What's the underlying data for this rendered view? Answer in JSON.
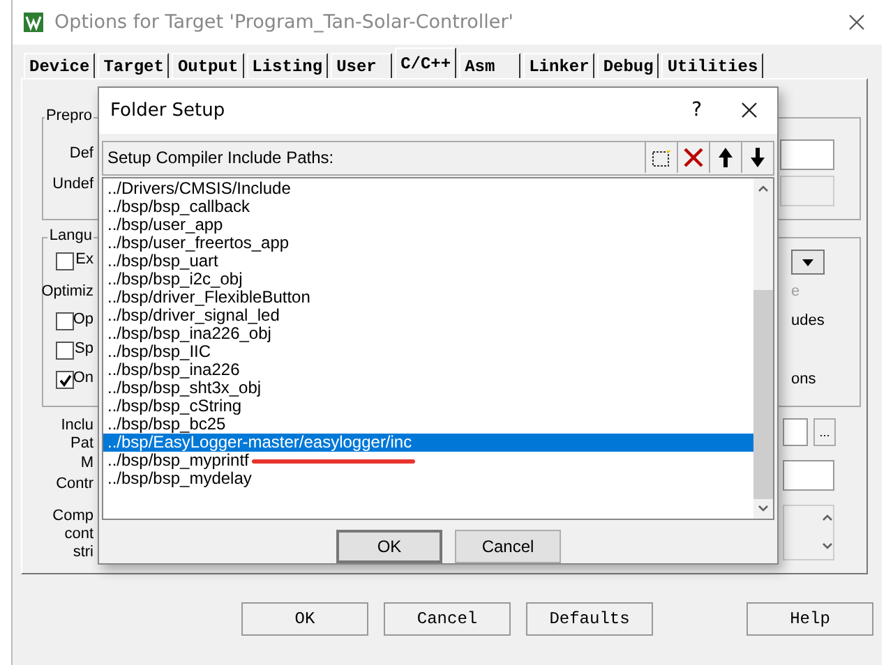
{
  "window": {
    "title": "Options for Target 'Program_Tan-Solar-Controller'"
  },
  "tabs": [
    {
      "label": "Device",
      "selected": false
    },
    {
      "label": "Target",
      "selected": false
    },
    {
      "label": "Output",
      "selected": false
    },
    {
      "label": "Listing",
      "selected": false
    },
    {
      "label": "User",
      "selected": false
    },
    {
      "label": "C/C++",
      "selected": true
    },
    {
      "label": "Asm",
      "selected": false
    },
    {
      "label": "Linker",
      "selected": false
    },
    {
      "label": "Debug",
      "selected": false
    },
    {
      "label": "Utilities",
      "selected": false
    }
  ],
  "background_panel": {
    "preprocessor_group": "Prepro",
    "define_label": "Def",
    "undefine_label": "Undef",
    "language_group": "Langu",
    "optimization_label": "Optimiz",
    "checkboxes": [
      {
        "label": "Ex",
        "checked": false
      },
      {
        "label": "Op",
        "checked": false
      },
      {
        "label": "Sp",
        "checked": false
      },
      {
        "label": "On",
        "checked": true
      }
    ],
    "right_labels": [
      {
        "text": "e",
        "disabled": true
      },
      {
        "text": "udes",
        "disabled": false
      },
      {
        "text": "ons",
        "disabled": false
      }
    ],
    "left_labels": [
      "Inclu",
      "Pat",
      "M",
      "Contr",
      "Comp",
      "cont",
      "stri"
    ],
    "browse_button": "..."
  },
  "dialog": {
    "title": "Folder Setup",
    "help": "?",
    "toolbar_label": "Setup Compiler Include Paths:",
    "paths": [
      {
        "text": "../Drivers/CMSIS/Include",
        "selected": false,
        "underlined": false
      },
      {
        "text": "../bsp/bsp_callback",
        "selected": false,
        "underlined": false
      },
      {
        "text": "../bsp/user_app",
        "selected": false,
        "underlined": false
      },
      {
        "text": "../bsp/user_freertos_app",
        "selected": false,
        "underlined": false
      },
      {
        "text": "../bsp/bsp_uart",
        "selected": false,
        "underlined": false
      },
      {
        "text": "../bsp/bsp_i2c_obj",
        "selected": false,
        "underlined": false
      },
      {
        "text": "../bsp/driver_FlexibleButton",
        "selected": false,
        "underlined": false
      },
      {
        "text": "../bsp/driver_signal_led",
        "selected": false,
        "underlined": false
      },
      {
        "text": "../bsp/bsp_ina226_obj",
        "selected": false,
        "underlined": false
      },
      {
        "text": "../bsp/bsp_IIC",
        "selected": false,
        "underlined": false
      },
      {
        "text": "../bsp/bsp_ina226",
        "selected": false,
        "underlined": false
      },
      {
        "text": "../bsp/bsp_sht3x_obj",
        "selected": false,
        "underlined": false
      },
      {
        "text": "../bsp/bsp_cString",
        "selected": false,
        "underlined": false
      },
      {
        "text": "../bsp/bsp_bc25",
        "selected": false,
        "underlined": false
      },
      {
        "text": "../bsp/EasyLogger-master/easylogger/inc",
        "selected": true,
        "underlined": false
      },
      {
        "text": "../bsp/bsp_myprintf",
        "selected": false,
        "underlined": true
      },
      {
        "text": "../bsp/bsp_mydelay",
        "selected": false,
        "underlined": false
      }
    ],
    "buttons": [
      "OK",
      "Cancel"
    ]
  },
  "buttons": [
    "OK",
    "Cancel",
    "Defaults",
    "Help"
  ]
}
